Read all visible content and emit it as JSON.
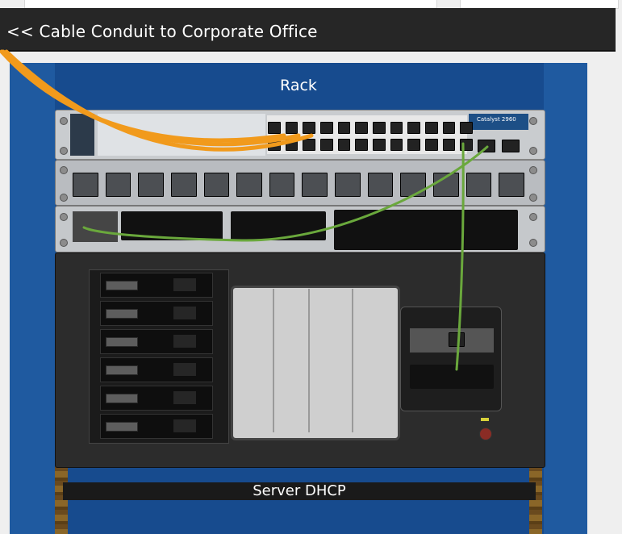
{
  "conduit": {
    "label": "<< Cable Conduit to Corporate Office"
  },
  "rack": {
    "title": "Rack"
  },
  "switch": {
    "model_label": "Catalyst 2960"
  },
  "server": {
    "label": "Server DHCP"
  },
  "colors": {
    "rack_blue": "#1f5aa0",
    "conduit_bg": "#262626",
    "cable_orange": "#f19a1c",
    "cable_green": "#6aa83c",
    "switch_brand_blue": "#1d4f86"
  }
}
